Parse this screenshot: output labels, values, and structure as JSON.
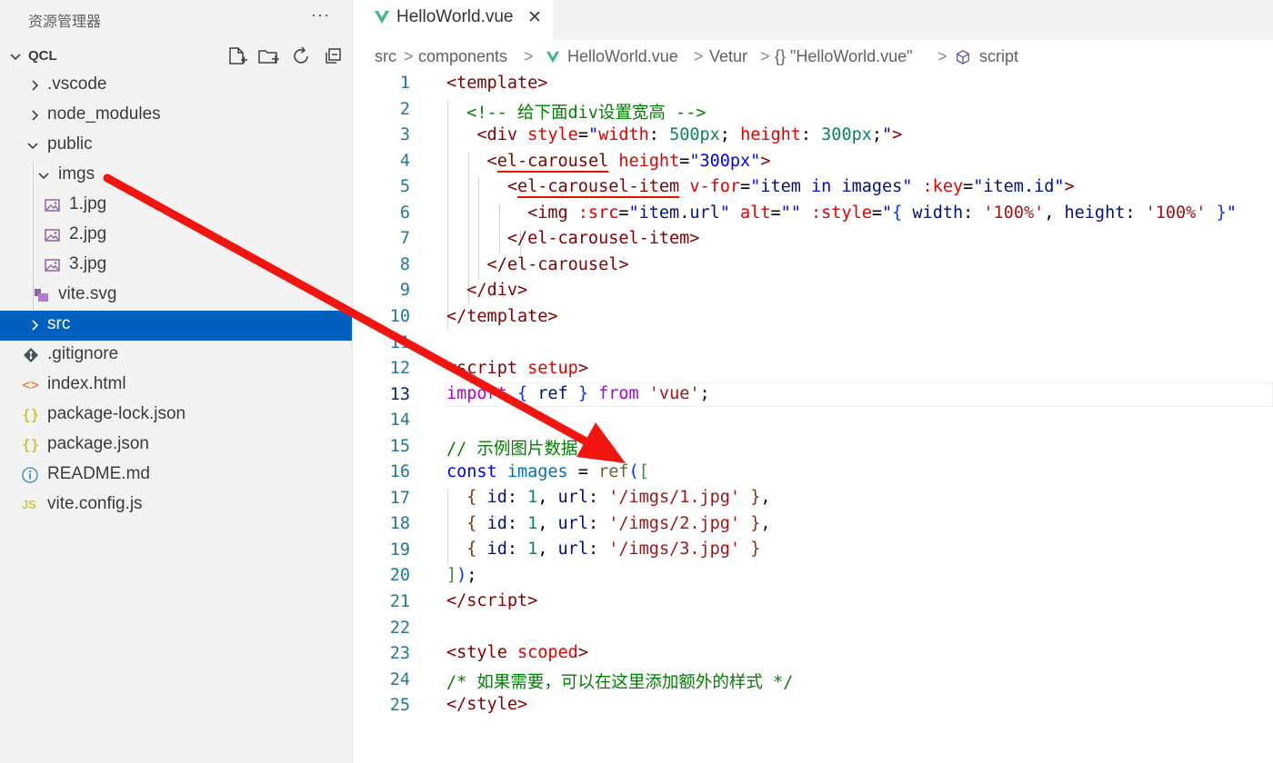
{
  "sidebar": {
    "title": "资源管理器",
    "more": "···",
    "root": "QCL",
    "items": [
      {
        "label": ".vscode",
        "kind": "folder",
        "expanded": false
      },
      {
        "label": "node_modules",
        "kind": "folder",
        "expanded": false
      },
      {
        "label": "public",
        "kind": "folder",
        "expanded": true
      },
      {
        "label": "imgs",
        "kind": "folder",
        "expanded": true
      },
      {
        "label": "1.jpg",
        "kind": "image"
      },
      {
        "label": "2.jpg",
        "kind": "image"
      },
      {
        "label": "3.jpg",
        "kind": "image"
      },
      {
        "label": "vite.svg",
        "kind": "svg"
      },
      {
        "label": "src",
        "kind": "folder",
        "expanded": false,
        "selected": true
      },
      {
        "label": ".gitignore",
        "kind": "git"
      },
      {
        "label": "index.html",
        "kind": "html",
        "icon_text": "<>"
      },
      {
        "label": "package-lock.json",
        "kind": "json",
        "icon_text": "{}"
      },
      {
        "label": "package.json",
        "kind": "json",
        "icon_text": "{}"
      },
      {
        "label": "README.md",
        "kind": "info"
      },
      {
        "label": "vite.config.js",
        "kind": "js",
        "icon_text": "JS"
      }
    ]
  },
  "tab": {
    "label": "HelloWorld.vue",
    "close": "✕"
  },
  "breadcrumb": {
    "items": [
      "src",
      "components",
      "HelloWorld.vue",
      "Vetur",
      "{} \"HelloWorld.vue\"",
      "script"
    ],
    "separator": ">"
  },
  "editor": {
    "active_line": 13,
    "line_numbers": [
      "1",
      "2",
      "3",
      "4",
      "5",
      "6",
      "7",
      "8",
      "9",
      "10",
      "11",
      "12",
      "13",
      "14",
      "15",
      "16",
      "17",
      "18",
      "19",
      "20",
      "21",
      "22",
      "23",
      "24",
      "25"
    ]
  },
  "colors": {
    "selection": "#0060c0",
    "annotation_arrow": "#f2140f",
    "vue_green": "#41b883"
  }
}
